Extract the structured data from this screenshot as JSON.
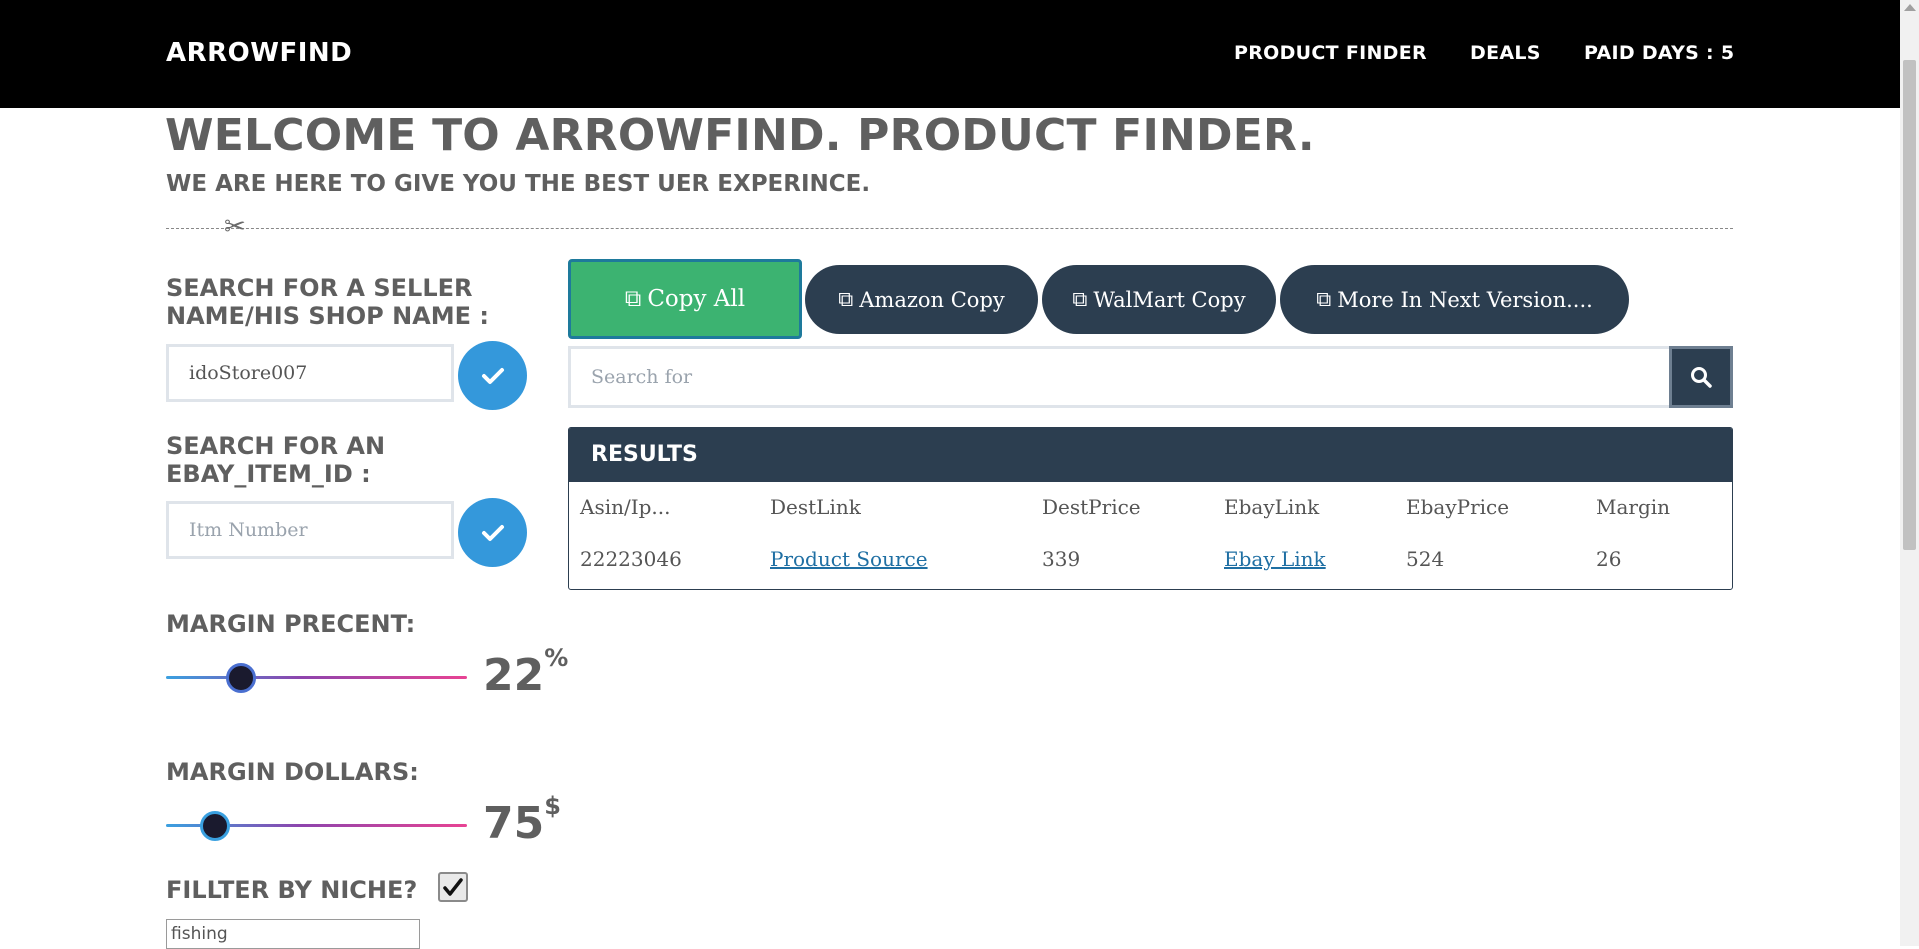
{
  "header": {
    "brand": "ARROWFIND",
    "nav": [
      {
        "label": "PRODUCT FINDER"
      },
      {
        "label": "DEALS"
      },
      {
        "label": "PAID DAYS : 5"
      }
    ]
  },
  "hero": {
    "title": "WELCOME TO ARROWFIND. PRODUCT FINDER.",
    "subtitle": "WE ARE HERE TO GIVE YOU THE BEST UER EXPERINCE."
  },
  "sidebar": {
    "seller_label": "SEARCH FOR A SELLER NAME/HIS SHOP NAME :",
    "seller_value": "idoStore007",
    "item_label": "SEARCH FOR AN EBAY_ITEM_ID :",
    "item_placeholder": "Itm Number",
    "margin_percent": {
      "label": "MARGIN PRECENT:",
      "value": "22",
      "unit": "%",
      "level": 0.22
    },
    "margin_dollars": {
      "label": "MARGIN DOLLARS:",
      "value": "75",
      "unit": "$",
      "level": 0.15
    },
    "niche": {
      "label": "FILLTER BY NICHE?",
      "checked": true,
      "value": "fishing"
    }
  },
  "actions": {
    "copy_all": "Copy All",
    "amazon_copy": "Amazon Copy",
    "walmart_copy": "WalMart Copy",
    "more": "More In Next Version...."
  },
  "search": {
    "placeholder": "Search for"
  },
  "results": {
    "title": "RESULTS",
    "columns": [
      "Asin/Ip...",
      "DestLink",
      "DestPrice",
      "EbayLink",
      "EbayPrice",
      "Margin"
    ],
    "rows": [
      [
        "22223046",
        "Product Source",
        "339",
        "Ebay Link",
        "524",
        "26"
      ]
    ]
  },
  "colors": {
    "accent_green": "#3cb371",
    "dark_navy": "#2c3e50",
    "check_blue": "#3498db"
  }
}
